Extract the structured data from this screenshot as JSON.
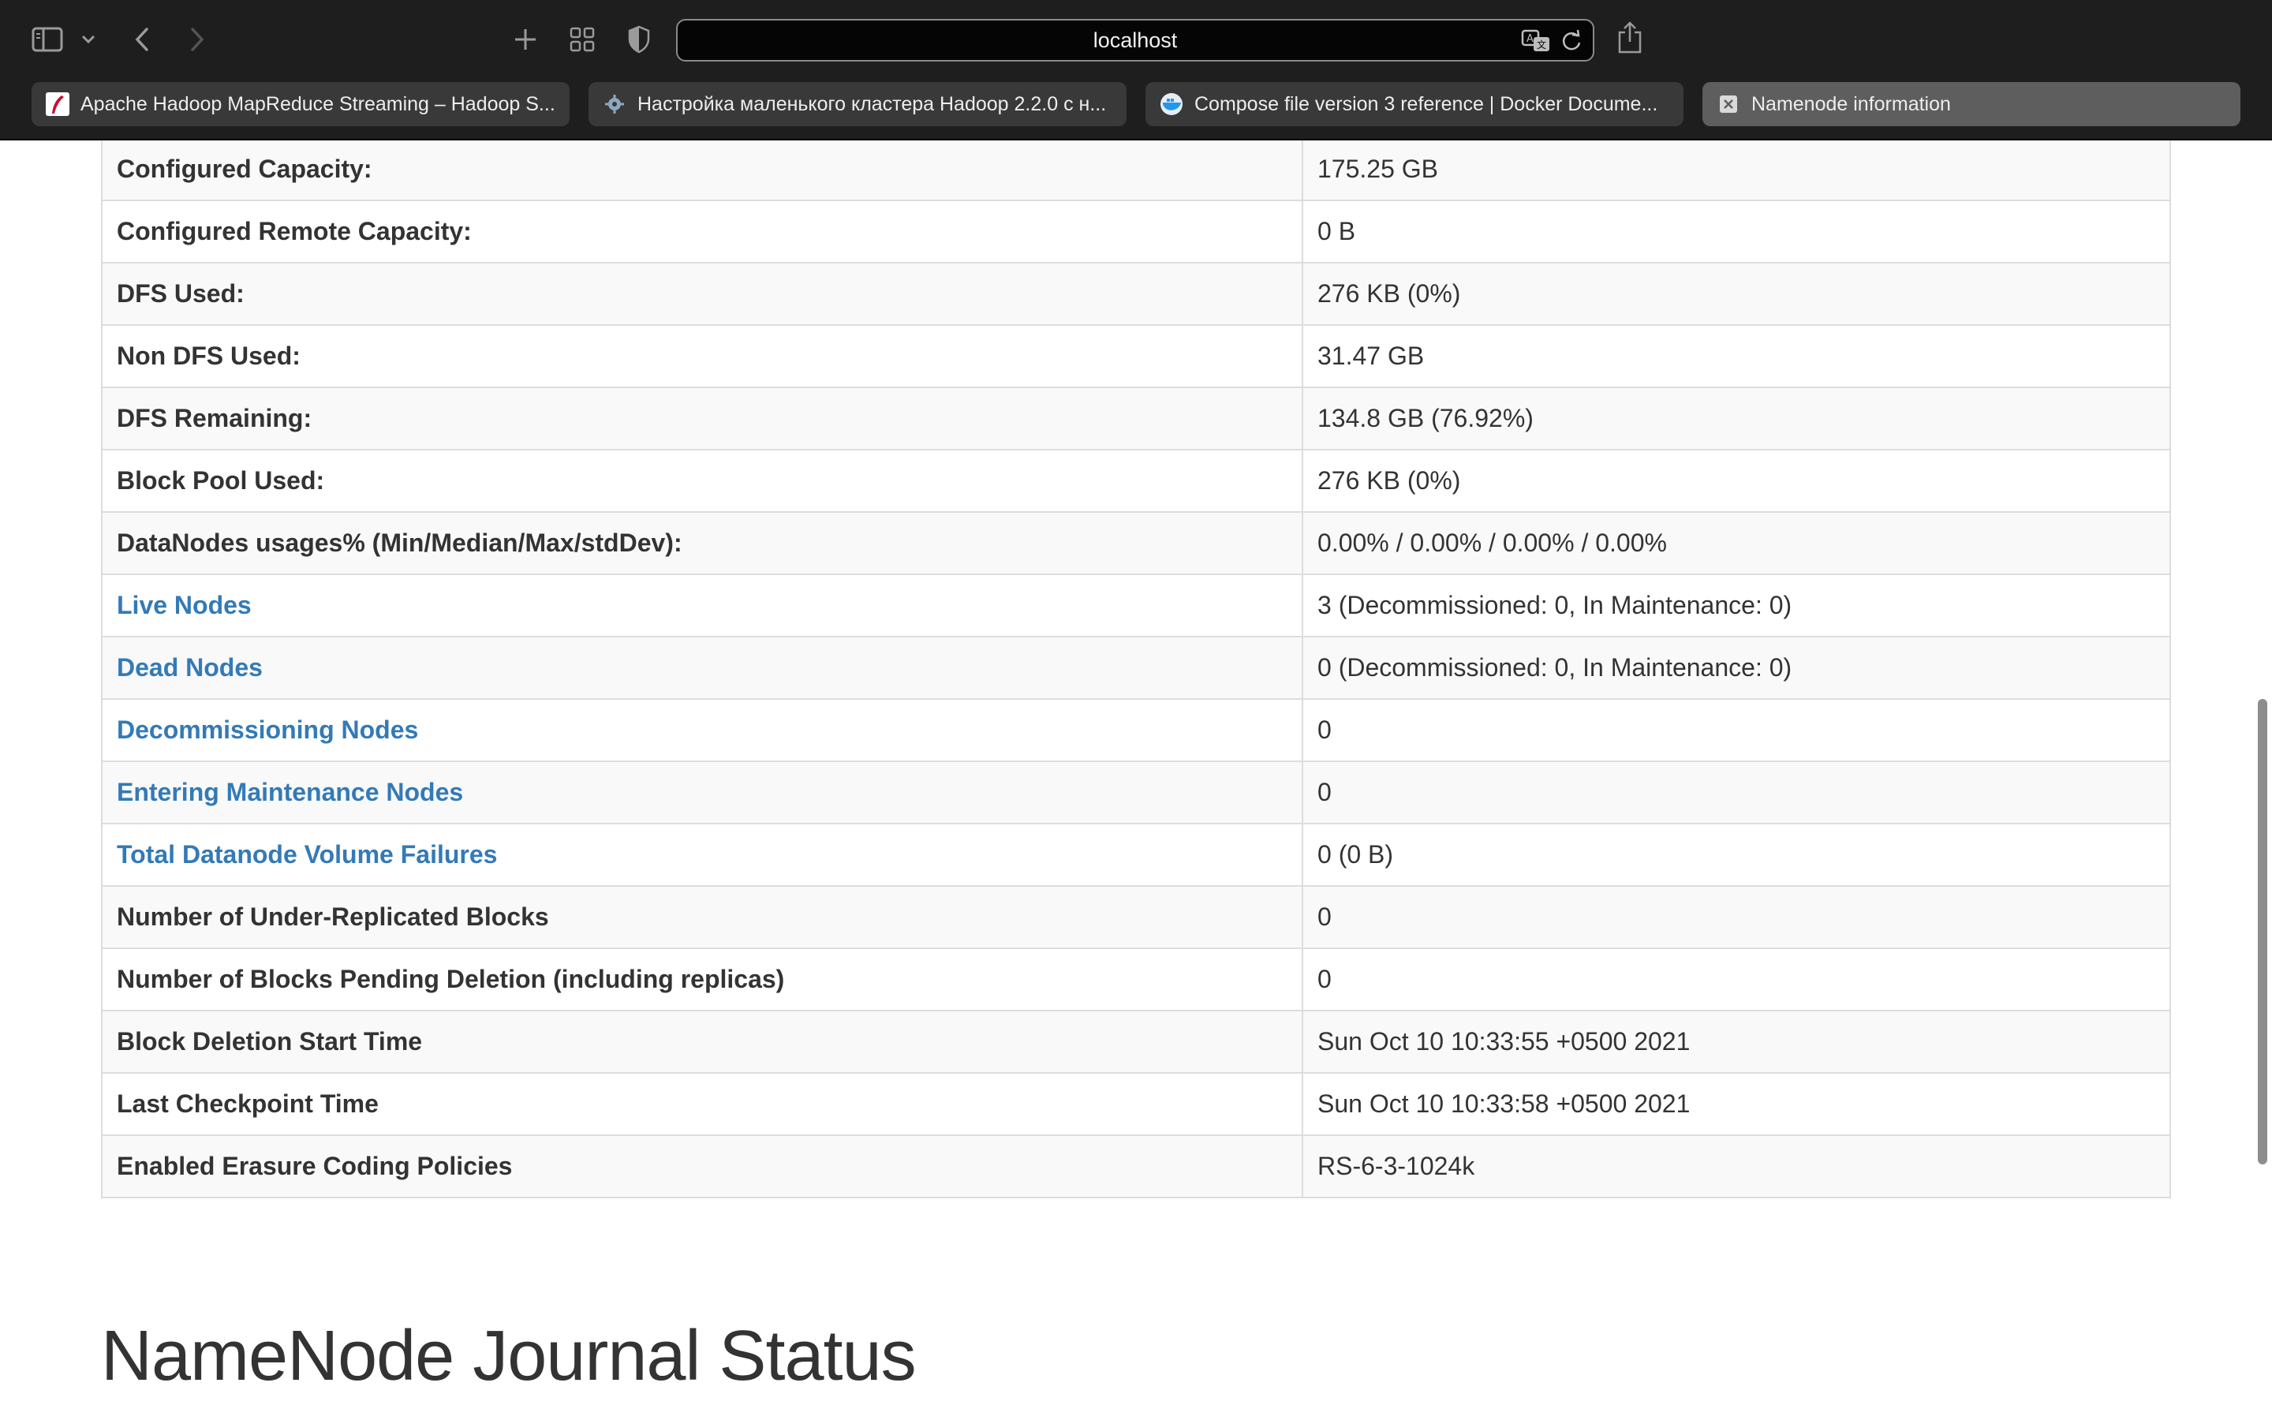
{
  "browser": {
    "url": "localhost",
    "tabs": [
      {
        "title": "Apache Hadoop MapReduce Streaming – Hadoop S...",
        "favicon": "hadoop-feather-icon",
        "active": false
      },
      {
        "title": "Настройка маленького кластера Hadoop 2.2.0 с н...",
        "favicon": "gear-favicon-icon",
        "active": false
      },
      {
        "title": "Compose file version 3 reference | Docker Docume...",
        "favicon": "docker-icon",
        "active": false
      },
      {
        "title": "Namenode information",
        "favicon": "close-tab-icon",
        "active": true
      }
    ]
  },
  "summary": {
    "rows": [
      {
        "label": "Configured Capacity:",
        "value": "175.25 GB",
        "link": false
      },
      {
        "label": "Configured Remote Capacity:",
        "value": "0 B",
        "link": false
      },
      {
        "label": "DFS Used:",
        "value": "276 KB (0%)",
        "link": false
      },
      {
        "label": "Non DFS Used:",
        "value": "31.47 GB",
        "link": false
      },
      {
        "label": "DFS Remaining:",
        "value": "134.8 GB (76.92%)",
        "link": false
      },
      {
        "label": "Block Pool Used:",
        "value": "276 KB (0%)",
        "link": false
      },
      {
        "label": "DataNodes usages% (Min/Median/Max/stdDev):",
        "value": "0.00% / 0.00% / 0.00% / 0.00%",
        "link": false
      },
      {
        "label": "Live Nodes",
        "value": "3 (Decommissioned: 0, In Maintenance: 0)",
        "link": true
      },
      {
        "label": "Dead Nodes",
        "value": "0 (Decommissioned: 0, In Maintenance: 0)",
        "link": true
      },
      {
        "label": "Decommissioning Nodes",
        "value": "0",
        "link": true
      },
      {
        "label": "Entering Maintenance Nodes",
        "value": "0",
        "link": true
      },
      {
        "label": "Total Datanode Volume Failures",
        "value": "0 (0 B)",
        "link": true
      },
      {
        "label": "Number of Under-Replicated Blocks",
        "value": "0",
        "link": false
      },
      {
        "label": "Number of Blocks Pending Deletion (including replicas)",
        "value": "0",
        "link": false
      },
      {
        "label": "Block Deletion Start Time",
        "value": "Sun Oct 10 10:33:55 +0500 2021",
        "link": false
      },
      {
        "label": "Last Checkpoint Time",
        "value": "Sun Oct 10 10:33:58 +0500 2021",
        "link": false
      },
      {
        "label": "Enabled Erasure Coding Policies",
        "value": "RS-6-3-1024k",
        "link": false
      }
    ]
  },
  "journal": {
    "heading": "NameNode Journal Status"
  },
  "colors": {
    "link": "#337ab7",
    "text": "#333333",
    "border": "#dddddd",
    "stripe": "#f9f9f9",
    "chrome_bg": "#1e1e1e"
  }
}
